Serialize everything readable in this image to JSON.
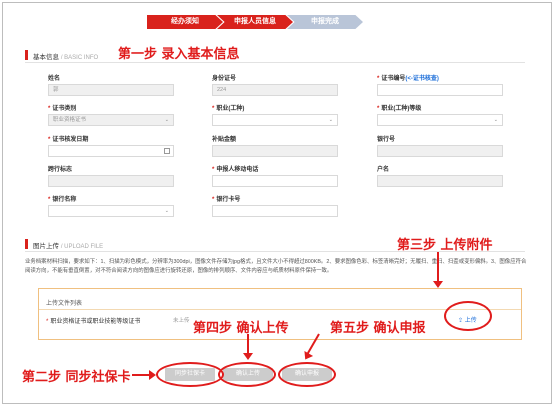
{
  "steps": [
    "经办须知",
    "申报人员信息",
    "申报完成"
  ],
  "basic_section": {
    "title": "基本信息",
    "subtitle": "BASIC INFO"
  },
  "upload_section": {
    "title": "图片上传",
    "subtitle": "UPLOAD FILE"
  },
  "annotations": {
    "step1": "第一步  录入基本信息",
    "step2": "第二步  同步社保卡",
    "step3": "第三步  上传附件",
    "step4": "第四步  确认上传",
    "step5": "第五步  确认申报"
  },
  "form": {
    "name_label": "姓名",
    "name_value": "郭",
    "id_label": "身份证号",
    "id_value": "224",
    "cert_no_label": "证书编号",
    "cert_no_link": "(<-证书核查)",
    "cert_type_label": "证书类别",
    "cert_type_value": "职业资格证书",
    "occupation_label": "职业(工种)",
    "occupation_level_label": "职业(工种)等级",
    "cert_date_label": "证书核发日期",
    "subsidy_label": "补贴金额",
    "bank_no_label": "银行号",
    "cross_flag_label": "跨行标志",
    "phone_label": "申报人移动电话",
    "account_name_label": "户名",
    "bank_name_label": "银行名称",
    "card_no_label": "银行卡号"
  },
  "upload": {
    "notice": "业务档案材料扫描，要求如下：1、扫描为彩色模式，分辨率为300dpi，图像文件存储为jpg格式，且文件大小不得超过800KB。2、要求图像色彩、标签清晰完好；无履扫、重扫、扫歪或变形偏斜。3、图像应符合阅读方向，不能有垂直倒置，对不符合阅读方向的图像应进行旋转还原，图像的排列顺序、文件内容应与纸质材料原件保持一致。",
    "list_title": "上传文件列表",
    "item_label": "职业资格证书或职业技能等级证书",
    "item_status": "未上传",
    "upload_button": "⇪ 上传"
  },
  "buttons": {
    "sync": "同步社保卡",
    "confirm_upload": "确认上传",
    "confirm_declare": "确认申报"
  },
  "colors": {
    "accent": "#d9221c",
    "annotation": "#e01c1c",
    "link": "#1e6fd9",
    "step_inactive": "#b9c5d8"
  }
}
